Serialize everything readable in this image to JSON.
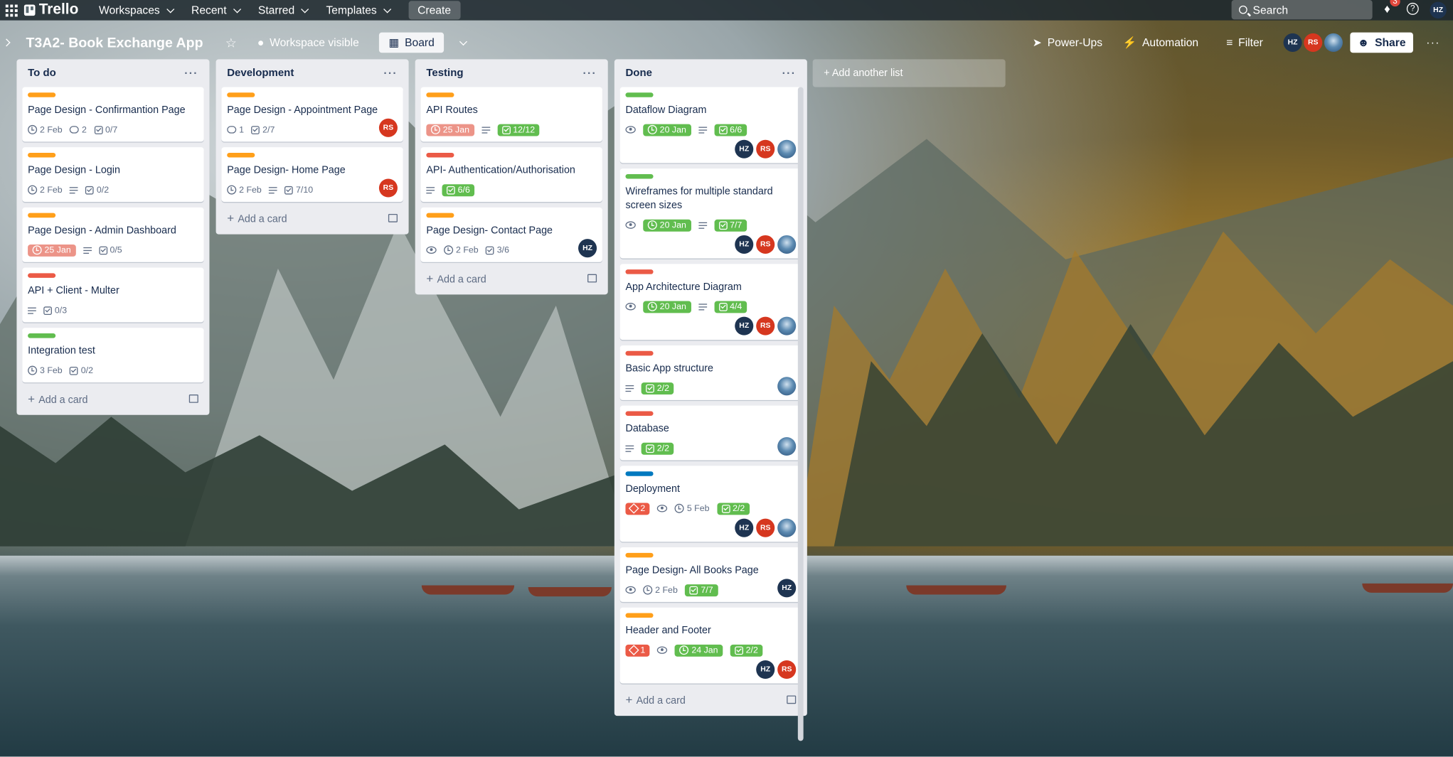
{
  "topbar": {
    "brand": "Trello",
    "nav": [
      "Workspaces",
      "Recent",
      "Starred",
      "Templates"
    ],
    "create_label": "Create",
    "search_placeholder": "Search",
    "notification_count": "3",
    "user_initials": "HZ"
  },
  "board": {
    "title": "T3A2- Book Exchange App",
    "visibility": "Workspace visible",
    "view": "Board",
    "power_ups": "Power-Ups",
    "automation": "Automation",
    "filter": "Filter",
    "share": "Share",
    "members": [
      "HZ",
      "RS"
    ],
    "add_list": "+ Add another list",
    "add_card": "Add a card"
  },
  "lists": [
    {
      "name": "To do",
      "cards": [
        {
          "label": "orange",
          "title": "Page Design - Confirmantion Page",
          "badges": [
            {
              "t": "date",
              "v": "2 Feb"
            },
            {
              "t": "comment",
              "v": "2"
            },
            {
              "t": "check",
              "v": "0/7"
            }
          ],
          "members": []
        },
        {
          "label": "orange",
          "title": "Page Design - Login",
          "badges": [
            {
              "t": "date",
              "v": "2 Feb"
            },
            {
              "t": "desc"
            },
            {
              "t": "check",
              "v": "0/2"
            }
          ],
          "members": []
        },
        {
          "label": "orange",
          "title": "Page Design - Admin Dashboard",
          "badges": [
            {
              "t": "date-overdue",
              "v": "25 Jan"
            },
            {
              "t": "desc"
            },
            {
              "t": "check",
              "v": "0/5"
            }
          ],
          "members": []
        },
        {
          "label": "red",
          "title": "API + Client - Multer",
          "badges": [
            {
              "t": "desc"
            },
            {
              "t": "check",
              "v": "0/3"
            }
          ],
          "members": []
        },
        {
          "label": "green",
          "title": "Integration test",
          "badges": [
            {
              "t": "date",
              "v": "3 Feb"
            },
            {
              "t": "check",
              "v": "0/2"
            }
          ],
          "members": []
        }
      ]
    },
    {
      "name": "Development",
      "cards": [
        {
          "label": "orange",
          "title": "Page Design - Appointment Page",
          "badges": [
            {
              "t": "comment",
              "v": "1"
            },
            {
              "t": "check",
              "v": "2/7"
            }
          ],
          "members": [
            "RS"
          ],
          "inline": true
        },
        {
          "label": "orange",
          "title": "Page Design- Home Page",
          "badges": [
            {
              "t": "date",
              "v": "2 Feb"
            },
            {
              "t": "desc"
            },
            {
              "t": "check",
              "v": "7/10"
            }
          ],
          "members": [
            "RS"
          ],
          "inline": true
        }
      ]
    },
    {
      "name": "Testing",
      "cards": [
        {
          "label": "orange",
          "title": "API Routes",
          "badges": [
            {
              "t": "date-overdue",
              "v": "25 Jan"
            },
            {
              "t": "desc"
            },
            {
              "t": "check-done",
              "v": "12/12"
            }
          ],
          "members": []
        },
        {
          "label": "red",
          "title": "API- Authentication/Authorisation",
          "badges": [
            {
              "t": "desc"
            },
            {
              "t": "check-done",
              "v": "6/6"
            }
          ],
          "members": []
        },
        {
          "label": "orange",
          "title": "Page Design- Contact Page",
          "badges": [
            {
              "t": "watch"
            },
            {
              "t": "date",
              "v": "2 Feb"
            },
            {
              "t": "check",
              "v": "3/6"
            }
          ],
          "members": [
            "HZ"
          ],
          "inline": true
        }
      ]
    },
    {
      "name": "Done",
      "cards": [
        {
          "label": "green",
          "title": "Dataflow Diagram",
          "badges": [
            {
              "t": "watch"
            },
            {
              "t": "date-done",
              "v": "20 Jan"
            },
            {
              "t": "desc"
            },
            {
              "t": "check-done",
              "v": "6/6"
            }
          ],
          "members": [
            "HZ",
            "RS",
            "photo"
          ]
        },
        {
          "label": "green",
          "title": "Wireframes for multiple standard screen sizes",
          "badges": [
            {
              "t": "watch"
            },
            {
              "t": "date-done",
              "v": "20 Jan"
            },
            {
              "t": "desc"
            },
            {
              "t": "check-done",
              "v": "7/7"
            }
          ],
          "members": [
            "HZ",
            "RS",
            "photo"
          ]
        },
        {
          "label": "red",
          "title": "App Architecture Diagram",
          "badges": [
            {
              "t": "watch"
            },
            {
              "t": "date-done",
              "v": "20 Jan"
            },
            {
              "t": "desc"
            },
            {
              "t": "check-done",
              "v": "4/4"
            }
          ],
          "members": [
            "HZ",
            "RS",
            "photo"
          ]
        },
        {
          "label": "red",
          "title": "Basic App structure",
          "badges": [
            {
              "t": "desc"
            },
            {
              "t": "check-done",
              "v": "2/2"
            }
          ],
          "members": [
            "photo"
          ],
          "inline": true
        },
        {
          "label": "red",
          "title": "Database",
          "badges": [
            {
              "t": "desc"
            },
            {
              "t": "check-done",
              "v": "2/2"
            }
          ],
          "members": [
            "photo"
          ],
          "inline": true
        },
        {
          "label": "blue",
          "title": "Deployment",
          "badges": [
            {
              "t": "tag",
              "v": "2"
            },
            {
              "t": "watch"
            },
            {
              "t": "date",
              "v": "5 Feb"
            },
            {
              "t": "check-done",
              "v": "2/2"
            }
          ],
          "members": [
            "HZ",
            "RS",
            "photo"
          ]
        },
        {
          "label": "orange",
          "title": "Page Design- All Books Page",
          "badges": [
            {
              "t": "watch"
            },
            {
              "t": "date",
              "v": "2 Feb"
            },
            {
              "t": "check-done",
              "v": "7/7"
            }
          ],
          "members": [
            "HZ"
          ],
          "inline": true
        },
        {
          "label": "orange",
          "title": "Header and Footer",
          "badges": [
            {
              "t": "tag",
              "v": "1"
            },
            {
              "t": "watch"
            },
            {
              "t": "date-done",
              "v": "24 Jan"
            },
            {
              "t": "check-done",
              "v": "2/2"
            }
          ],
          "members": [
            "HZ",
            "RS"
          ]
        }
      ]
    }
  ]
}
